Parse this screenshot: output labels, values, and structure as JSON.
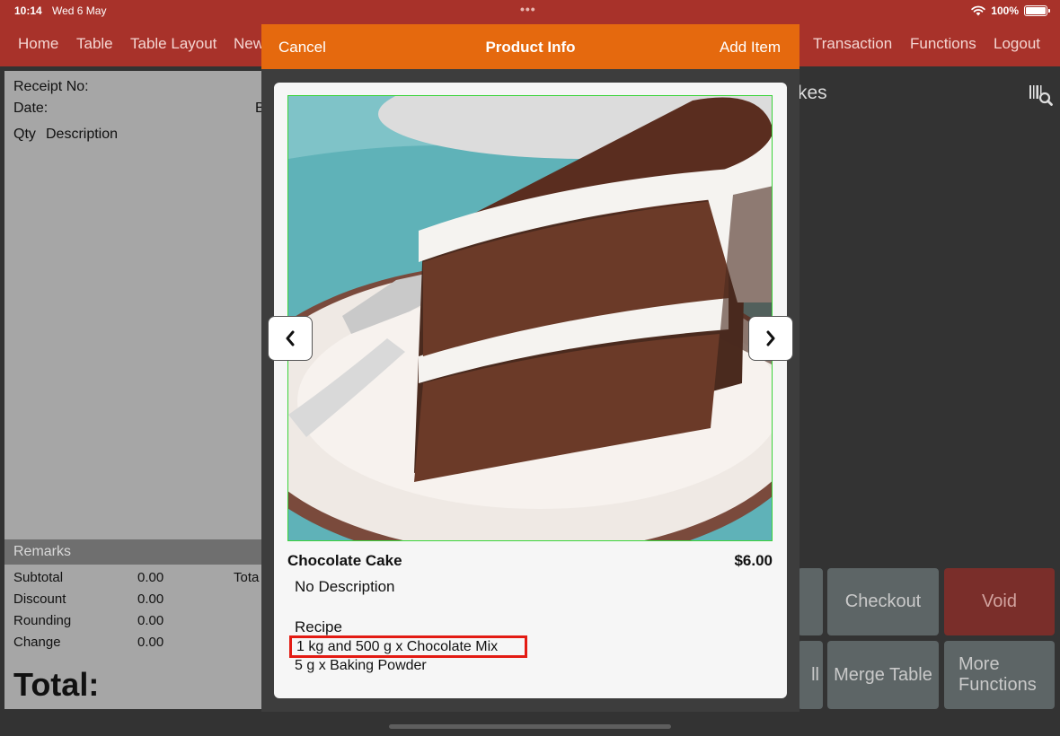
{
  "status_bar": {
    "time": "10:14",
    "date": "Wed 6 May",
    "battery": "100%"
  },
  "nav": {
    "home": "Home",
    "table": "Table",
    "table_layout": "Table Layout",
    "new": "New",
    "transaction": "Transaction",
    "functions": "Functions",
    "logout": "Logout"
  },
  "receipt": {
    "receipt_no_label": "Receipt No:",
    "date_label": "Date:",
    "partial_b": "B",
    "qty_label": "Qty",
    "description_label": "Description",
    "remarks_label": "Remarks",
    "subtotal_label": "Subtotal",
    "subtotal_value": "0.00",
    "total_partial": "Tota",
    "discount_label": "Discount",
    "discount_value": "0.00",
    "rounding_label": "Rounding",
    "rounding_value": "0.00",
    "change_label": "Change",
    "change_value": "0.00",
    "total_label": "Total:"
  },
  "category": {
    "title_partial": "kes"
  },
  "actions": {
    "checkout": "Checkout",
    "void": "Void",
    "partial_ll": "ll",
    "merge_table": "Merge Table",
    "more_functions": "More Functions"
  },
  "modal": {
    "cancel": "Cancel",
    "title": "Product Info",
    "add_item": "Add Item",
    "product_name": "Chocolate Cake",
    "price": "$6.00",
    "description": "No Description",
    "recipe_heading": "Recipe",
    "recipe_items": [
      "1 kg and 500 g x Chocolate Mix",
      "5 g x Baking Powder"
    ]
  },
  "colors": {
    "nav_bar": "#a8322a",
    "modal_header": "#e5690e",
    "highlight_border": "#e31b13",
    "photo_border": "#3ad43a"
  },
  "icons": [
    "wifi-icon",
    "battery-icon",
    "barcode-search-icon",
    "chevron-left-icon",
    "chevron-right-icon"
  ]
}
